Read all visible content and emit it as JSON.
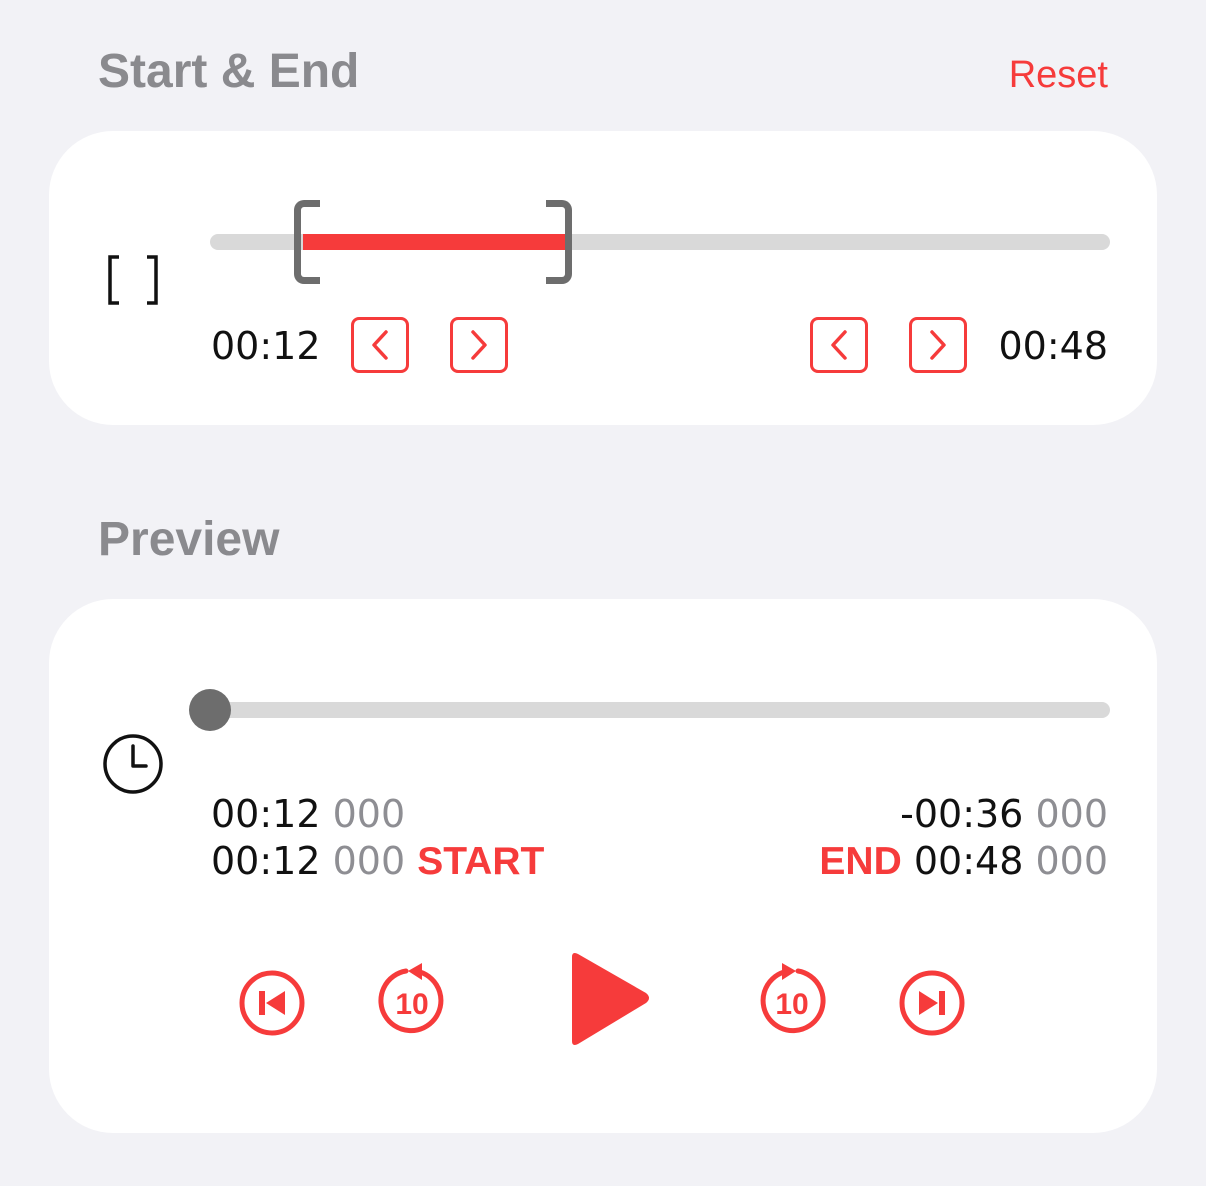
{
  "start_end": {
    "title": "Start & End",
    "reset_label": "Reset",
    "range_icon": "brackets-icon",
    "start_time": "00:12",
    "end_time": "00:48",
    "step_icons": [
      "chevron-left-icon",
      "chevron-right-icon"
    ]
  },
  "preview": {
    "title": "Preview",
    "clock_icon": "clock-icon",
    "position_fraction": 0.0,
    "current_time": "00:12",
    "current_ms": "000",
    "remaining_time": "-00:36",
    "remaining_ms": "000",
    "start_time": "00:12",
    "start_ms": "000",
    "start_label": "START",
    "end_label": "END",
    "end_time": "00:48",
    "end_ms": "000",
    "controls": [
      "skip-to-start-icon",
      "rewind-10-icon",
      "play-icon",
      "forward-10-icon",
      "skip-to-end-icon"
    ],
    "skip_amount": "10"
  },
  "colors": {
    "accent": "#f63b3b",
    "background": "#f2f2f6",
    "card": "#ffffff",
    "track": "#d9d9d9",
    "handle": "#6d6d6d",
    "secondary_text": "#8e8e93"
  }
}
